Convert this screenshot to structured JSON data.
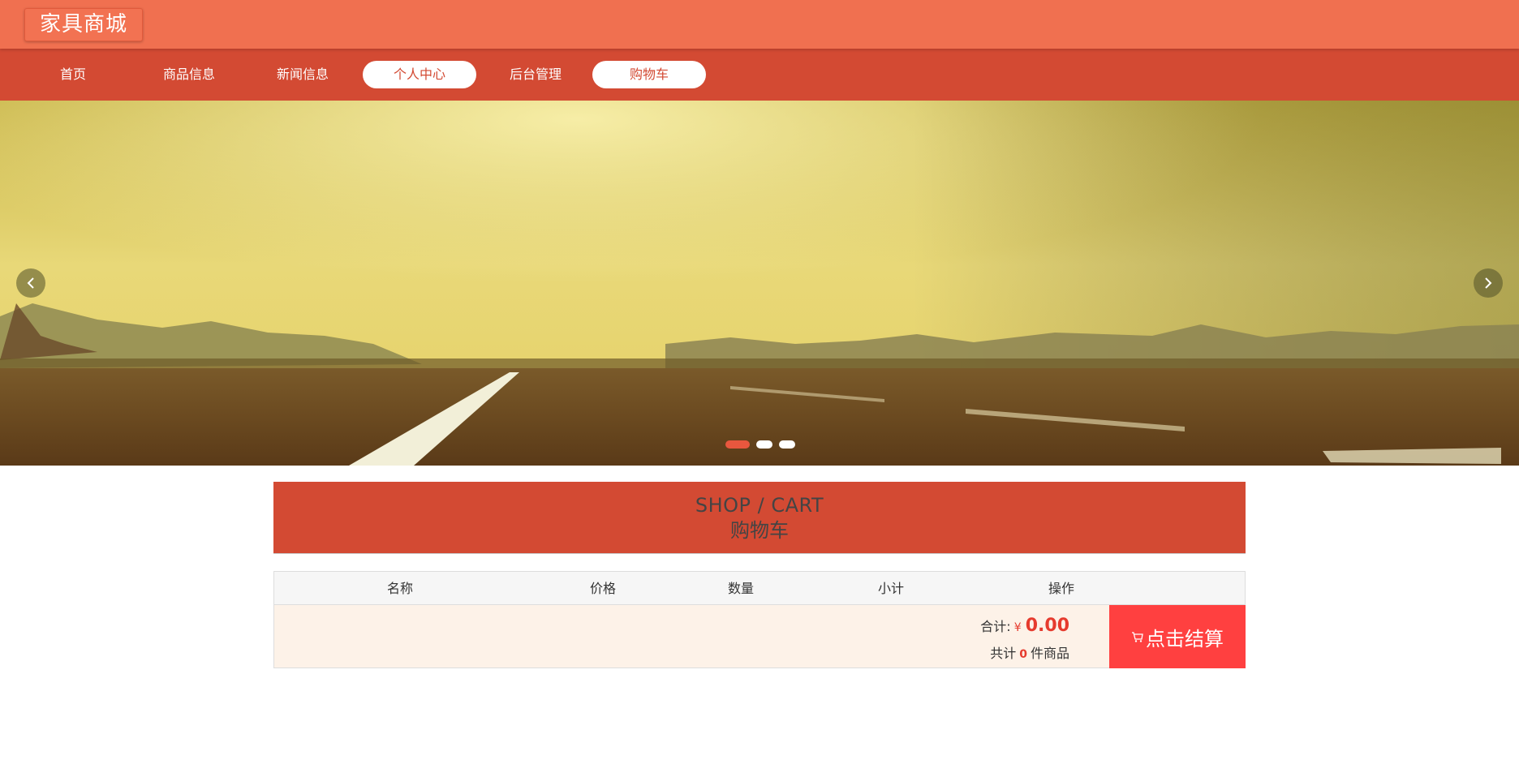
{
  "header": {
    "logo_text": "家具商城"
  },
  "nav": {
    "items": [
      {
        "label": "首页",
        "active": false
      },
      {
        "label": "商品信息",
        "active": false
      },
      {
        "label": "新闻信息",
        "active": false
      },
      {
        "label": "个人中心",
        "active": true
      },
      {
        "label": "后台管理",
        "active": false
      },
      {
        "label": "购物车",
        "active": true
      }
    ]
  },
  "banner": {
    "prev_icon": "chevron-left-icon",
    "next_icon": "chevron-right-icon",
    "slide_count": 3,
    "active_slide": 1
  },
  "cart": {
    "title_en": "SHOP / CART",
    "title_zh": "购物车",
    "columns": [
      "名称",
      "价格",
      "数量",
      "小计",
      "操作"
    ],
    "rows": [],
    "total_label": "合计:",
    "currency_symbol": "¥",
    "total_amount": "0.00",
    "count_prefix": "共计",
    "count_value": "0",
    "count_suffix": "件商品",
    "checkout_label": "点击结算",
    "checkout_icon": "cart-icon"
  },
  "colors": {
    "topbar": "#f07050",
    "navbar": "#d34a33",
    "accent_red": "#ff4040",
    "price_red": "#e63b2e",
    "footer_bg": "#fdf2e8"
  }
}
